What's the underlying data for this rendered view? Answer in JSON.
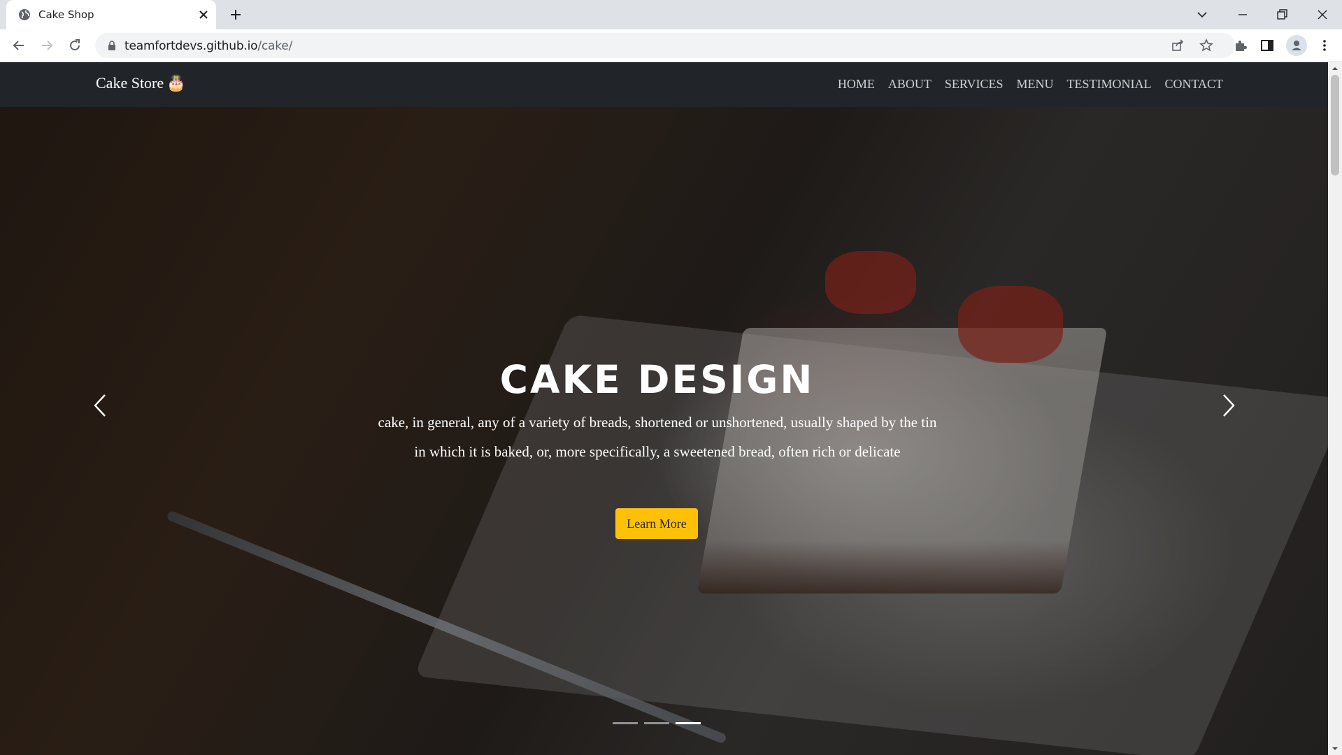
{
  "browser": {
    "tab_title": "Cake Shop",
    "url_host": "teamfortdevs.github.io",
    "url_path": "/cake/"
  },
  "site": {
    "brand": "Cake Store",
    "brand_icon": "🎂",
    "nav": [
      "HOME",
      "ABOUT",
      "SERVICES",
      "MENU",
      "TESTIMONIAL",
      "CONTACT"
    ]
  },
  "hero": {
    "title": "CAKE DESIGN",
    "text": "cake, in general, any of a variety of breads, shortened or unshortened, usually shaped by the tin in which it is baked, or, more specifically, a sweetened bread, often rich or delicate",
    "button": "Learn More",
    "slides": 3,
    "active_slide": 3
  },
  "colors": {
    "navbar": "#212529",
    "accent": "#ffc107",
    "chrome_bg": "#dee1e6"
  }
}
